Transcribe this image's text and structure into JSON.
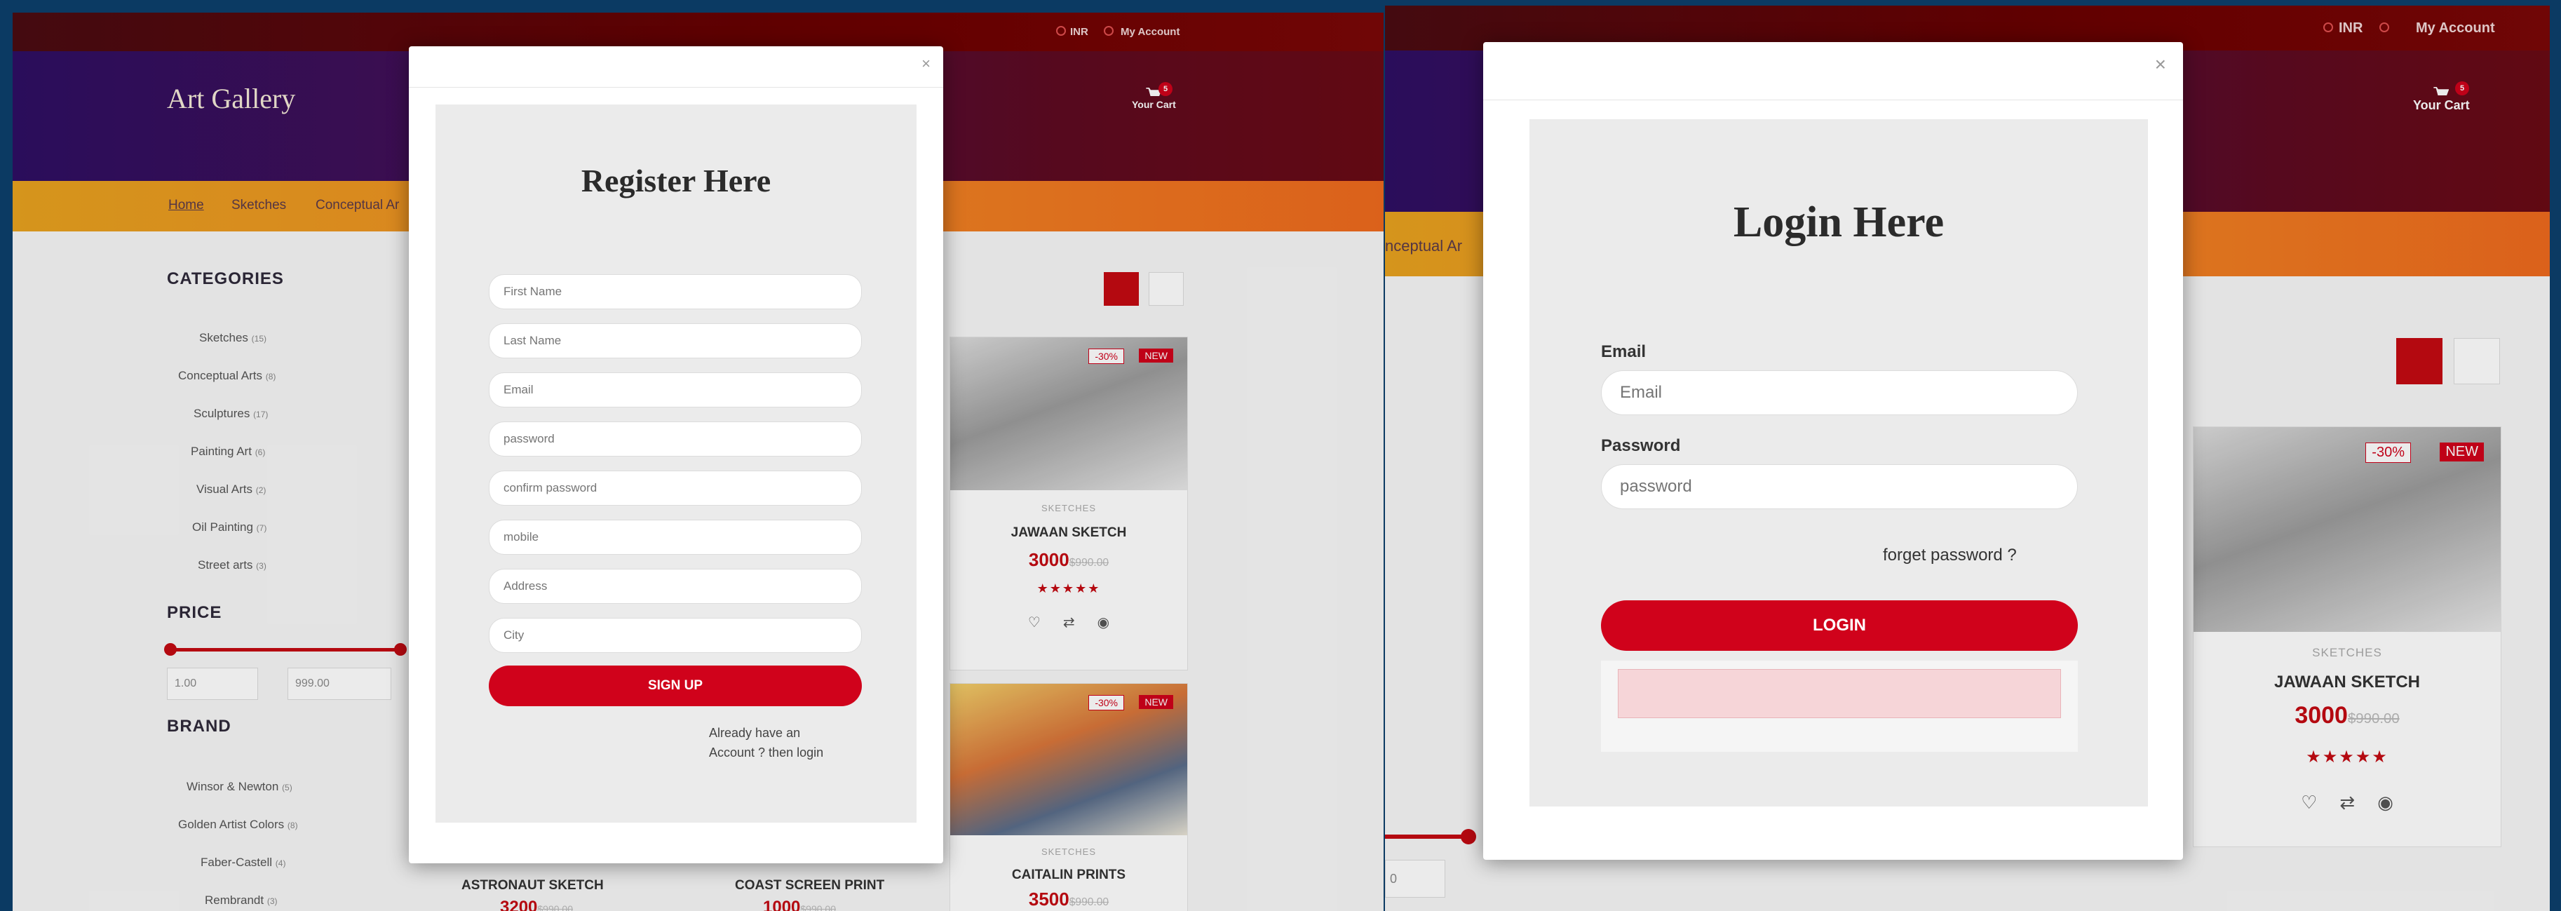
{
  "left": {
    "topbar": {
      "currency": "INR",
      "account": "My Account"
    },
    "logo": "Art Gallery",
    "cart": {
      "label": "Your Cart",
      "count": "5"
    },
    "nav": [
      "Home",
      "Sketches",
      "Conceptual Ar"
    ],
    "categories_title": "CATEGORIES",
    "categories": [
      {
        "name": "Sketches",
        "count": "(15)"
      },
      {
        "name": "Conceptual Arts",
        "count": "(8)"
      },
      {
        "name": "Sculptures",
        "count": "(17)"
      },
      {
        "name": "Painting Art",
        "count": "(6)"
      },
      {
        "name": "Visual Arts",
        "count": "(2)"
      },
      {
        "name": "Oil Painting",
        "count": "(7)"
      },
      {
        "name": "Street arts",
        "count": "(3)"
      }
    ],
    "price_title": "PRICE",
    "price_min": "1.00",
    "price_max": "999.00",
    "brand_title": "BRAND",
    "brands": [
      {
        "name": "Winsor & Newton",
        "count": "(5)"
      },
      {
        "name": "Golden Artist Colors",
        "count": "(8)"
      },
      {
        "name": "Faber-Castell",
        "count": "(4)"
      },
      {
        "name": "Rembrandt",
        "count": "(3)"
      }
    ],
    "cards": [
      {
        "type": "SKETCHES",
        "name": "JAWAAN SKETCH",
        "price": "3000",
        "old": "$990.00",
        "sale": "-30%",
        "new": "NEW"
      },
      {
        "type": "SKETCHES",
        "name": "CAITALIN PRINTS",
        "price": "3500",
        "old": "$990.00",
        "sale": "-30%",
        "new": "NEW"
      }
    ],
    "bottom_names": [
      "ASTRONAUT SKETCH",
      "COAST SCREEN PRINT"
    ],
    "bottom_prices": [
      {
        "price": "3200",
        "old": "$990.00"
      },
      {
        "price": "1000",
        "old": "$990.00"
      }
    ],
    "register": {
      "title": "Register Here",
      "fields": [
        "First Name",
        "Last Name",
        "Email",
        "password",
        "confirm password",
        "mobile",
        "Address",
        "City"
      ],
      "submit": "SIGN UP",
      "login_prompt_1": "Already have an",
      "login_prompt_2": "Account ? then login"
    }
  },
  "right": {
    "topbar": {
      "currency": "INR",
      "account": "My Account"
    },
    "cart": {
      "label": "Your Cart",
      "count": "5"
    },
    "nav_partial": "nceptual Ar",
    "card": {
      "type": "SKETCHES",
      "name": "JAWAAN SKETCH",
      "price": "3000",
      "old": "$990.00",
      "sale": "-30%",
      "new": "NEW"
    },
    "price_partial": "0",
    "login": {
      "title": "Login Here",
      "email_label": "Email",
      "email_placeholder": "Email",
      "password_label": "Password",
      "password_placeholder": "password",
      "forgot": "forget password ?",
      "submit": "LOGIN"
    }
  },
  "colors": {
    "accent": "#d0021b",
    "topbar": "#6b0000",
    "nav": "#f08a24"
  }
}
